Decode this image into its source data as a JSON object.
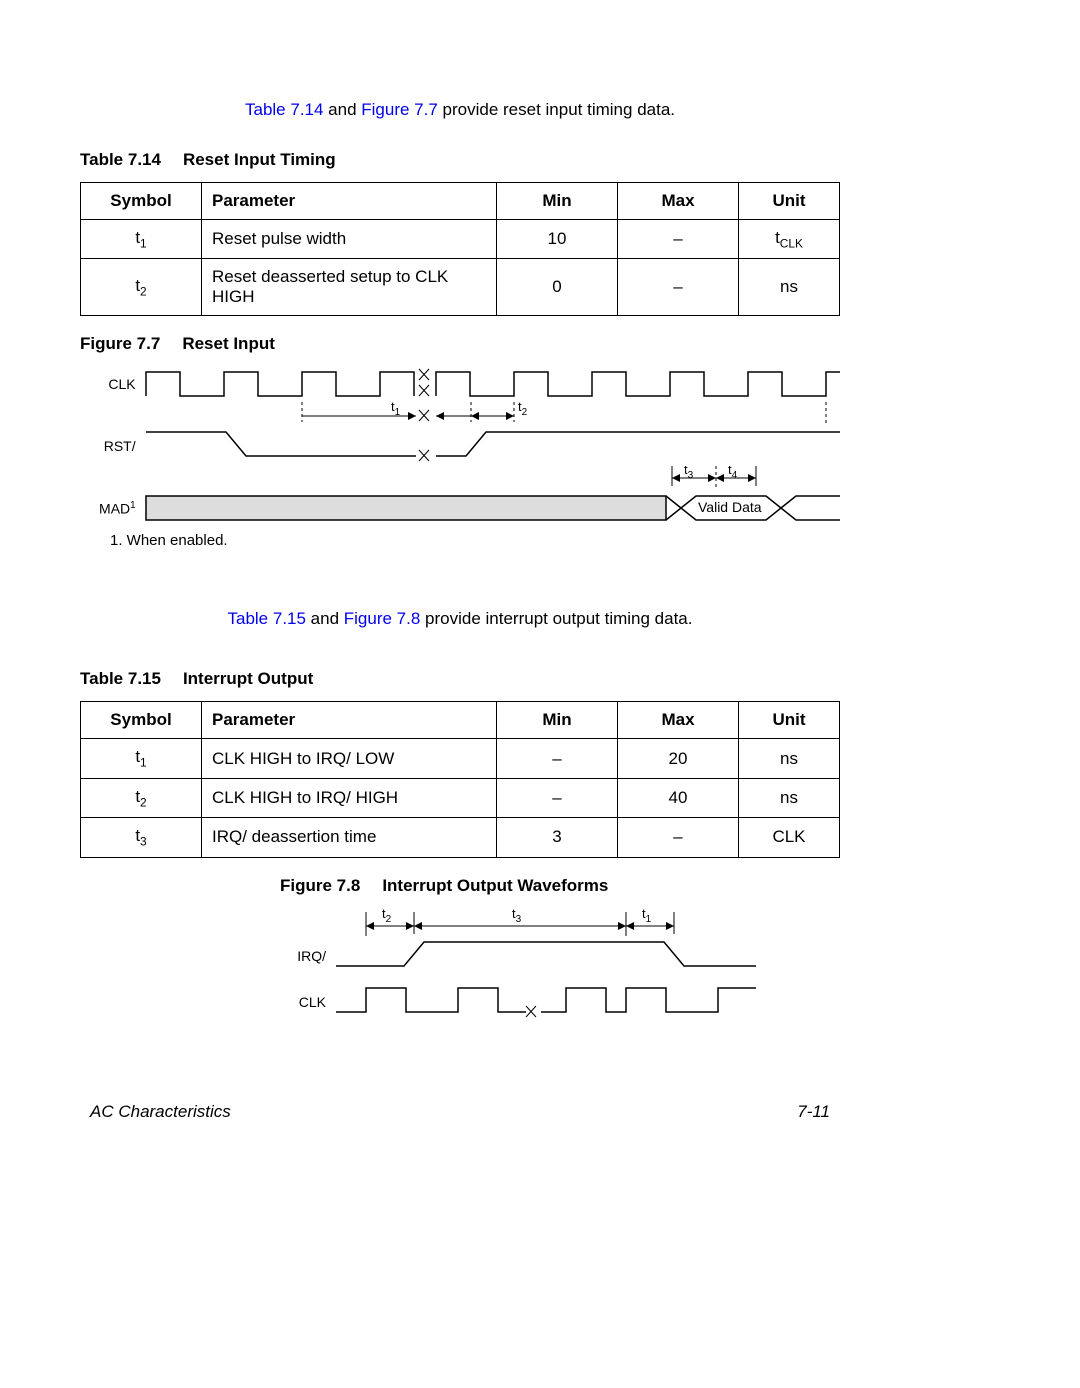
{
  "intro1": {
    "link1": "Table 7.14",
    "mid": " and ",
    "link2": "Figure 7.7",
    "tail": " provide reset input timing data."
  },
  "table714": {
    "number": "Table 7.14",
    "title": "Reset Input Timing",
    "headers": {
      "symbol": "Symbol",
      "param": "Parameter",
      "min": "Min",
      "max": "Max",
      "unit": "Unit"
    },
    "rows": [
      {
        "sym_base": "t",
        "sym_sub": "1",
        "param": "Reset pulse width",
        "min": "10",
        "max": "–",
        "unit_base": "t",
        "unit_sub": "CLK"
      },
      {
        "sym_base": "t",
        "sym_sub": "2",
        "param": "Reset deasserted setup to CLK HIGH",
        "min": "0",
        "max": "–",
        "unit_base": "ns",
        "unit_sub": ""
      }
    ]
  },
  "figure77": {
    "number": "Figure 7.7",
    "title": "Reset Input",
    "labels": {
      "clk": "CLK",
      "rst": "RST/",
      "mad": "MAD",
      "mad_sup": "1",
      "valid": "Valid Data"
    },
    "tmarks": {
      "t1_base": "t",
      "t1_sub": "1",
      "t2_base": "t",
      "t2_sub": "2",
      "t3_base": "t",
      "t3_sub": "3",
      "t4_base": "t",
      "t4_sub": "4"
    },
    "footnote": "1.  When enabled."
  },
  "intro2": {
    "link1": "Table 7.15",
    "mid": " and ",
    "link2": "Figure 7.8",
    "tail": " provide interrupt output timing data."
  },
  "table715": {
    "number": "Table 7.15",
    "title": "Interrupt Output",
    "headers": {
      "symbol": "Symbol",
      "param": "Parameter",
      "min": "Min",
      "max": "Max",
      "unit": "Unit"
    },
    "rows": [
      {
        "sym_base": "t",
        "sym_sub": "1",
        "param": "CLK HIGH to IRQ/ LOW",
        "min": "–",
        "max": "20",
        "unit": "ns"
      },
      {
        "sym_base": "t",
        "sym_sub": "2",
        "param": "CLK HIGH to IRQ/ HIGH",
        "min": "–",
        "max": "40",
        "unit": "ns"
      },
      {
        "sym_base": "t",
        "sym_sub": "3",
        "param": "IRQ/ deassertion time",
        "min": "3",
        "max": "–",
        "unit": "CLK"
      }
    ]
  },
  "figure78": {
    "number": "Figure 7.8",
    "title": "Interrupt Output Waveforms",
    "labels": {
      "irq": "IRQ/",
      "clk": "CLK"
    },
    "tmarks": {
      "t1_base": "t",
      "t1_sub": "1",
      "t2_base": "t",
      "t2_sub": "2",
      "t3_base": "t",
      "t3_sub": "3"
    }
  },
  "footer": {
    "left": "AC Characteristics",
    "right": "7-11"
  }
}
